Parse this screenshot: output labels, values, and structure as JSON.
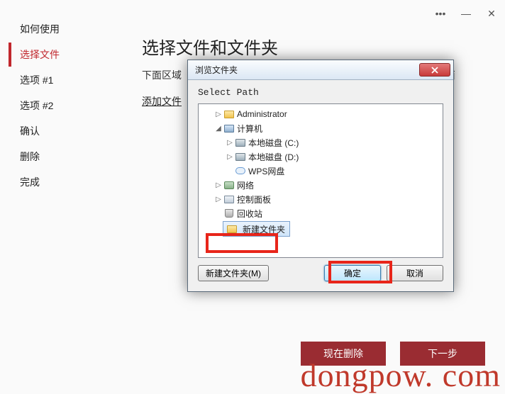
{
  "titlebar": {
    "more": "•••",
    "min": "—",
    "close": "✕"
  },
  "sidebar": {
    "items": [
      {
        "label": "如何使用"
      },
      {
        "label": "选择文件"
      },
      {
        "label": "选项 #1"
      },
      {
        "label": "选项 #2"
      },
      {
        "label": "确认"
      },
      {
        "label": "删除"
      },
      {
        "label": "完成"
      }
    ],
    "active_index": 1
  },
  "main": {
    "title": "选择文件和文件夹",
    "desc_pre": "下面区域",
    "desc_post": "你可以点击下面",
    "add_link": "添加文件"
  },
  "dialog": {
    "title": "浏览文件夹",
    "label": "Select Path",
    "tree": [
      {
        "indent": 1,
        "arrow": "▷",
        "icon": "folder",
        "label": "Administrator"
      },
      {
        "indent": 1,
        "arrow": "◢",
        "icon": "comp",
        "label": "计算机"
      },
      {
        "indent": 2,
        "arrow": "▷",
        "icon": "drive",
        "label": "本地磁盘 (C:)"
      },
      {
        "indent": 2,
        "arrow": "▷",
        "icon": "drive",
        "label": "本地磁盘 (D:)"
      },
      {
        "indent": 2,
        "arrow": "",
        "icon": "cloud",
        "label": "WPS网盘"
      },
      {
        "indent": 1,
        "arrow": "▷",
        "icon": "net",
        "label": "网络"
      },
      {
        "indent": 1,
        "arrow": "▷",
        "icon": "panel",
        "label": "控制面板"
      },
      {
        "indent": 1,
        "arrow": "",
        "icon": "bin",
        "label": "回收站"
      }
    ],
    "selected": {
      "icon": "folder",
      "label": "新建文件夹"
    },
    "btn_newfolder": "新建文件夹(M)",
    "btn_ok": "确定",
    "btn_cancel": "取消"
  },
  "footer": {
    "delete_now": "现在删除",
    "next": "下一步"
  },
  "watermark": "dongpow. com"
}
